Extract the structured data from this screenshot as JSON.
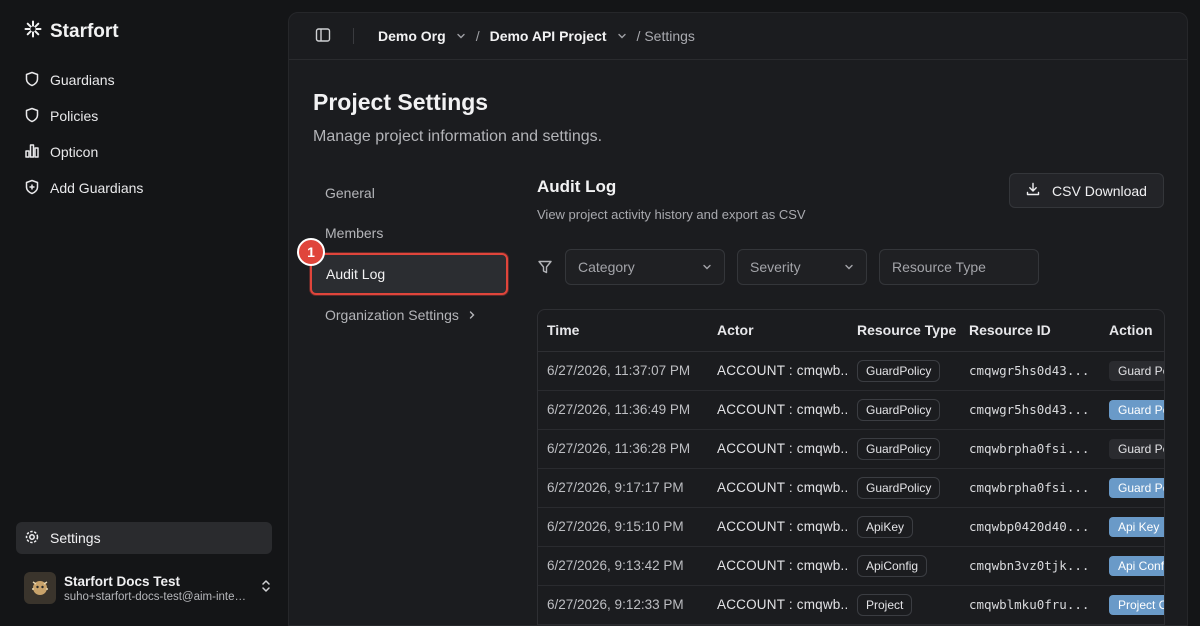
{
  "app": {
    "name": "Starfort"
  },
  "sidebar": {
    "items": [
      {
        "label": "Guardians",
        "icon": "shield-icon"
      },
      {
        "label": "Policies",
        "icon": "shield-icon"
      },
      {
        "label": "Opticon",
        "icon": "bar-chart-icon"
      },
      {
        "label": "Add Guardians",
        "icon": "shield-plus-icon"
      }
    ],
    "settings_label": "Settings",
    "user": {
      "name": "Starfort Docs Test",
      "email": "suho+starfort-docs-test@aim-intelligence.com"
    }
  },
  "breadcrumb": {
    "org": "Demo Org",
    "project": "Demo API Project",
    "current": "/ Settings"
  },
  "page": {
    "title": "Project Settings",
    "subtitle": "Manage project information and settings."
  },
  "subnav": {
    "items": [
      {
        "label": "General"
      },
      {
        "label": "Members"
      },
      {
        "label": "Audit Log"
      },
      {
        "label": "Organization Settings"
      }
    ],
    "marker": "1"
  },
  "audit": {
    "title": "Audit Log",
    "subtitle": "View project activity history and export as CSV",
    "csv_label": "CSV Download",
    "filters": {
      "category": "Category",
      "severity": "Severity",
      "resource_type": "Resource Type"
    },
    "columns": [
      "Time",
      "Actor",
      "Resource Type",
      "Resource ID",
      "Action"
    ],
    "rows": [
      {
        "time": "6/27/2026, 11:37:07 PM",
        "actor": "ACCOUNT : cmqwb...",
        "resource_type": "GuardPolicy",
        "resource_id": "cmqwgr5hs0d43...",
        "action": "Guard Policy",
        "style": "dark"
      },
      {
        "time": "6/27/2026, 11:36:49 PM",
        "actor": "ACCOUNT : cmqwb...",
        "resource_type": "GuardPolicy",
        "resource_id": "cmqwgr5hs0d43...",
        "action": "Guard Policy",
        "style": "blue"
      },
      {
        "time": "6/27/2026, 11:36:28 PM",
        "actor": "ACCOUNT : cmqwb...",
        "resource_type": "GuardPolicy",
        "resource_id": "cmqwbrpha0fsi...",
        "action": "Guard Policy",
        "style": "dark"
      },
      {
        "time": "6/27/2026, 9:17:17 PM",
        "actor": "ACCOUNT : cmqwb...",
        "resource_type": "GuardPolicy",
        "resource_id": "cmqwbrpha0fsi...",
        "action": "Guard Policy",
        "style": "blue"
      },
      {
        "time": "6/27/2026, 9:15:10 PM",
        "actor": "ACCOUNT : cmqwb...",
        "resource_type": "ApiKey",
        "resource_id": "cmqwbp0420d40...",
        "action": "Api Key",
        "style": "blue"
      },
      {
        "time": "6/27/2026, 9:13:42 PM",
        "actor": "ACCOUNT : cmqwb...",
        "resource_type": "ApiConfig",
        "resource_id": "cmqwbn3vz0tjk...",
        "action": "Api Config",
        "style": "blue"
      },
      {
        "time": "6/27/2026, 9:12:33 PM",
        "actor": "ACCOUNT : cmqwb...",
        "resource_type": "Project",
        "resource_id": "cmqwblmku0fru...",
        "action": "Project Created",
        "style": "blue"
      }
    ]
  },
  "colors": {
    "accent_red": "#e0453b",
    "action_blue": "#6a9ac8"
  }
}
